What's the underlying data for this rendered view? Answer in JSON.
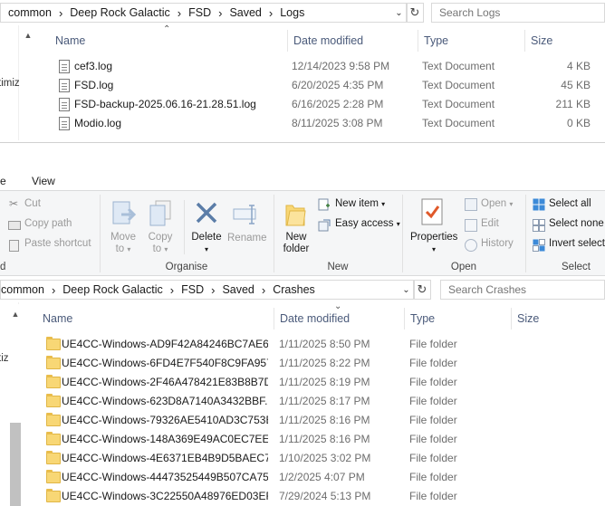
{
  "win1": {
    "address": [
      "common",
      "Deep Rock Galactic",
      "FSD",
      "Saved",
      "Logs"
    ],
    "search_placeholder": "Search Logs",
    "nav_text": "timiz",
    "columns": {
      "name": "Name",
      "date": "Date modified",
      "type": "Type",
      "size": "Size"
    },
    "files": [
      {
        "name": "cef3.log",
        "date": "12/14/2023 9:58 PM",
        "type": "Text Document",
        "size": "4 KB"
      },
      {
        "name": "FSD.log",
        "date": "6/20/2025 4:35 PM",
        "type": "Text Document",
        "size": "45 KB"
      },
      {
        "name": "FSD-backup-2025.06.16-21.28.51.log",
        "date": "6/16/2025 2:28 PM",
        "type": "Text Document",
        "size": "211 KB"
      },
      {
        "name": "Modio.log",
        "date": "8/11/2025 3:08 PM",
        "type": "Text Document",
        "size": "0 KB"
      }
    ]
  },
  "win2": {
    "tabs": {
      "partial": "e",
      "view": "View"
    },
    "ribbon": {
      "clipboard": {
        "cut": "Cut",
        "copy_path": "Copy path",
        "paste_shortcut": "Paste shortcut",
        "partial_label": "d"
      },
      "organise": {
        "move_to": [
          "Move",
          "to"
        ],
        "copy_to": [
          "Copy",
          "to"
        ],
        "delete": "Delete",
        "rename": "Rename",
        "label": "Organise"
      },
      "new": {
        "new_folder": [
          "New",
          "folder"
        ],
        "new_item": "New item",
        "easy_access": "Easy access",
        "label": "New"
      },
      "open": {
        "properties": "Properties",
        "open": "Open",
        "edit": "Edit",
        "history": "History",
        "label": "Open"
      },
      "select": {
        "select_all": "Select all",
        "select_none": "Select none",
        "invert": "Invert select",
        "label": "Select"
      }
    },
    "address": [
      "common",
      "Deep Rock Galactic",
      "FSD",
      "Saved",
      "Crashes"
    ],
    "search_placeholder": "Search Crashes",
    "nav_text": "tiz",
    "columns": {
      "name": "Name",
      "date": "Date modified",
      "type": "Type",
      "size": "Size"
    },
    "folders": [
      {
        "name": "UE4CC-Windows-AD9F42A84246BC7AE6...",
        "date": "1/11/2025 8:50 PM",
        "type": "File folder"
      },
      {
        "name": "UE4CC-Windows-6FD4E7F540F8C9FA957...",
        "date": "1/11/2025 8:22 PM",
        "type": "File folder"
      },
      {
        "name": "UE4CC-Windows-2F46A478421E83B8B7D...",
        "date": "1/11/2025 8:19 PM",
        "type": "File folder"
      },
      {
        "name": "UE4CC-Windows-623D8A7140A3432BBF...",
        "date": "1/11/2025 8:17 PM",
        "type": "File folder"
      },
      {
        "name": "UE4CC-Windows-79326AE5410AD3C753E...",
        "date": "1/11/2025 8:16 PM",
        "type": "File folder"
      },
      {
        "name": "UE4CC-Windows-148A369E49AC0EC7EE...",
        "date": "1/11/2025 8:16 PM",
        "type": "File folder"
      },
      {
        "name": "UE4CC-Windows-4E6371EB4B9D5BAEC7...",
        "date": "1/10/2025 3:02 PM",
        "type": "File folder"
      },
      {
        "name": "UE4CC-Windows-44473525449B507CA75...",
        "date": "1/2/2025 4:07 PM",
        "type": "File folder"
      },
      {
        "name": "UE4CC-Windows-3C22550A48976ED03EF...",
        "date": "7/29/2024 5:13 PM",
        "type": "File folder"
      }
    ]
  }
}
